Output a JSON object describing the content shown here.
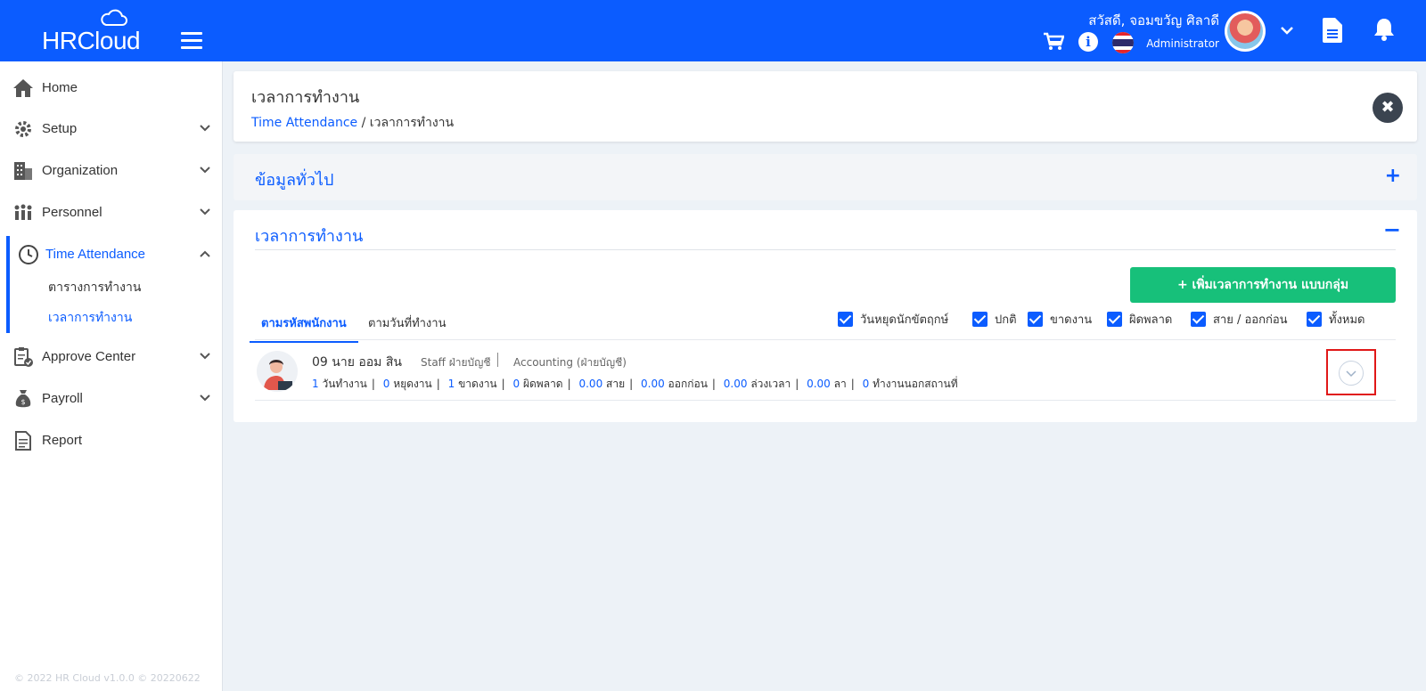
{
  "header": {
    "brand": "HRCloud",
    "greeting": "สวัสดี, จอมขวัญ ศิลาดี",
    "role": "Administrator"
  },
  "sidebar": {
    "items": [
      {
        "label": "Home",
        "icon": "home-icon"
      },
      {
        "label": "Setup",
        "icon": "gear-icon"
      },
      {
        "label": "Organization",
        "icon": "building-icon"
      },
      {
        "label": "Personnel",
        "icon": "people-icon"
      },
      {
        "label": "Time Attendance",
        "icon": "clock-icon"
      },
      {
        "label": "Approve Center",
        "icon": "clipboard-check-icon"
      },
      {
        "label": "Payroll",
        "icon": "money-bag-icon"
      },
      {
        "label": "Report",
        "icon": "report-icon"
      }
    ],
    "sub_items": [
      "ตารางการทำงาน",
      "เวลาการทำงาน"
    ],
    "footer": "© 2022 HR Cloud v1.0.0 © 20220622"
  },
  "page": {
    "title": "เวลาการทำงาน",
    "breadcrumb_link": "Time Attendance",
    "breadcrumb_sep": "/",
    "breadcrumb_current": "เวลาการทำงาน"
  },
  "general_section": {
    "title": "ข้อมูลทั่วไป",
    "toggle": "+"
  },
  "work_section": {
    "title": "เวลาการทำงาน",
    "toggle": "−",
    "add_button": "+ เพิ่มเวลาการทำงาน แบบกลุ่ม",
    "tabs": [
      "ตามรหัสพนักงาน",
      "ตามวันที่ทำงาน"
    ],
    "filters": [
      "วันหยุดนักขัตฤกษ์",
      "ปกติ",
      "ขาดงาน",
      "ผิดพลาด",
      "สาย / ออกก่อน",
      "ทั้งหมด"
    ]
  },
  "employee": {
    "name": "09 นาย ออม สิน",
    "position": "Staff ฝ่ายบัญชี",
    "department": "Accounting (ฝ่ายบัญชี)",
    "stats": [
      {
        "value": "1",
        "label": "วันทำงาน"
      },
      {
        "value": "0",
        "label": "หยุดงาน"
      },
      {
        "value": "1",
        "label": "ขาดงาน"
      },
      {
        "value": "0",
        "label": "ผิดพลาด"
      },
      {
        "value": "0.00",
        "label": "สาย"
      },
      {
        "value": "0.00",
        "label": "ออกก่อน"
      },
      {
        "value": "0.00",
        "label": "ล่วงเวลา"
      },
      {
        "value": "0.00",
        "label": "ลา"
      },
      {
        "value": "0",
        "label": "ทำงานนอกสถานที่"
      }
    ]
  },
  "colors": {
    "primary": "#0b5cff",
    "success": "#17c07a",
    "highlight": "#e01818"
  }
}
